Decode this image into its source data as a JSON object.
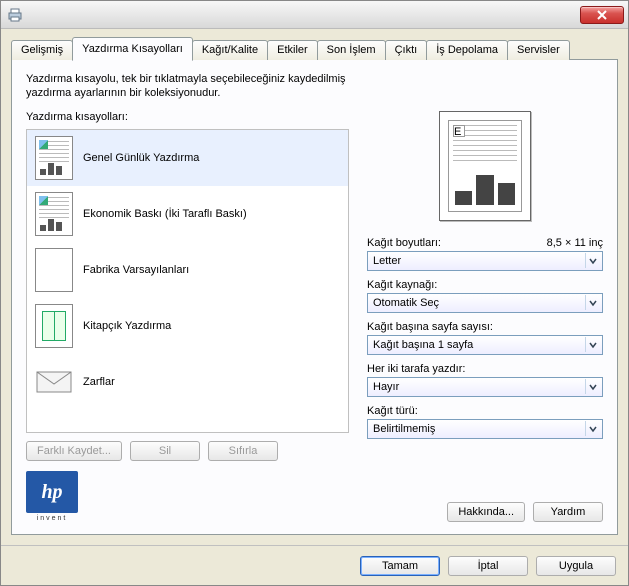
{
  "titlebar": {
    "close_label": "X"
  },
  "tabs": [
    {
      "label": "Gelişmiş"
    },
    {
      "label": "Yazdırma Kısayolları"
    },
    {
      "label": "Kağıt/Kalite"
    },
    {
      "label": "Etkiler"
    },
    {
      "label": "Son İşlem"
    },
    {
      "label": "Çıktı"
    },
    {
      "label": "İş Depolama"
    },
    {
      "label": "Servisler"
    }
  ],
  "active_tab_index": 1,
  "intro": "Yazdırma kısayolu, tek bir tıklatmayla seçebileceğiniz kaydedilmiş yazdırma ayarlarının bir koleksiyonudur.",
  "shortcuts_label": "Yazdırma kısayolları:",
  "shortcuts": [
    {
      "label": "Genel Günlük Yazdırma"
    },
    {
      "label": "Ekonomik Baskı (İki Taraflı Baskı)"
    },
    {
      "label": "Fabrika Varsayılanları"
    },
    {
      "label": "Kitapçık Yazdırma"
    },
    {
      "label": "Zarflar"
    }
  ],
  "selected_shortcut_index": 0,
  "left_buttons": {
    "save": "Farklı Kaydet...",
    "delete": "Sil",
    "reset": "Sıfırla"
  },
  "right": {
    "paper_size_label": "Kağıt boyutları:",
    "paper_size_dim": "8,5 × 11 inç",
    "paper_size_value": "Letter",
    "paper_source_label": "Kağıt kaynağı:",
    "paper_source_value": "Otomatik Seç",
    "pages_per_sheet_label": "Kağıt başına sayfa sayısı:",
    "pages_per_sheet_value": "Kağıt başına 1 sayfa",
    "duplex_label": "Her iki tarafa yazdır:",
    "duplex_value": "Hayır",
    "paper_type_label": "Kağıt türü:",
    "paper_type_value": "Belirtilmemiş"
  },
  "logo_sub": "invent",
  "about_btn": "Hakkında...",
  "help_btn": "Yardım",
  "footer": {
    "ok": "Tamam",
    "cancel": "İptal",
    "apply": "Uygula"
  }
}
